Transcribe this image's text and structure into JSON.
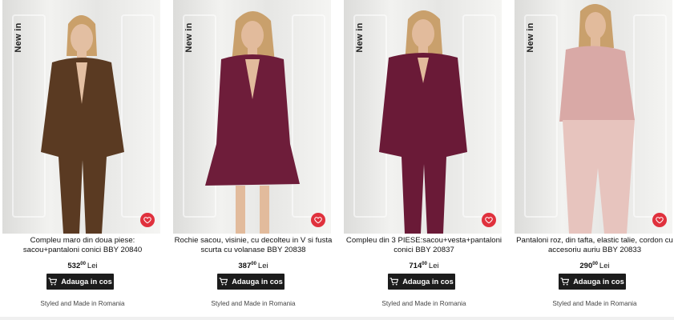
{
  "products": [
    {
      "badge": "New in",
      "title": "Compleu maro din doua piese: sacou+pantaloni conici BBY 20840",
      "price_int": "532",
      "price_dec": "00",
      "currency": "Lei",
      "button": "Adauga in cos",
      "note": "Styled and Made in Romania",
      "outfit_color": "#5a3a22"
    },
    {
      "badge": "New in",
      "title": "Rochie sacou, visinie, cu decolteu in V si fusta scurta cu volanase BBY 20838",
      "price_int": "387",
      "price_dec": "00",
      "currency": "Lei",
      "button": "Adauga in cos",
      "note": "Styled and Made in Romania",
      "outfit_color": "#6e1d3a"
    },
    {
      "badge": "New in",
      "title": "Compleu din 3 PIESE:sacou+vesta+pantaloni conici BBY 20837",
      "price_int": "714",
      "price_dec": "00",
      "currency": "Lei",
      "button": "Adauga in cos",
      "note": "Styled and Made in Romania",
      "outfit_color": "#6a1a37"
    },
    {
      "badge": "New in",
      "title": "Pantaloni roz, din tafta, elastic talie, cordon cu accesoriu auriu BBY 20833",
      "price_int": "290",
      "price_dec": "00",
      "currency": "Lei",
      "button": "Adauga in cos",
      "note": "Styled and Made in Romania",
      "outfit_color": "#e7c4be"
    }
  ],
  "colors": {
    "accent_red": "#e0313d",
    "button_bg": "#1c1c1c"
  },
  "icons": {
    "favorite": "heart-icon",
    "cart": "cart-icon"
  }
}
